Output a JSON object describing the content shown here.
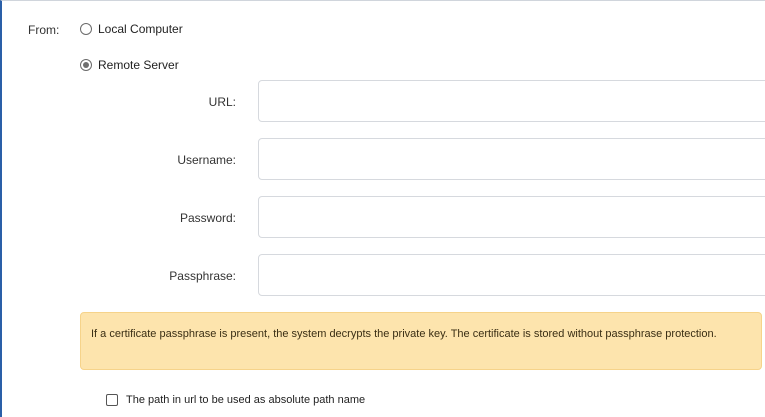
{
  "source": {
    "from_label": "From:",
    "options": [
      {
        "label": "Local Computer",
        "selected": false
      },
      {
        "label": "Remote Server",
        "selected": true
      }
    ]
  },
  "remote": {
    "url": {
      "label": "URL:",
      "value": ""
    },
    "username": {
      "label": "Username:",
      "value": ""
    },
    "password": {
      "label": "Password:",
      "value": ""
    },
    "passphrase": {
      "label": "Passphrase:",
      "value": ""
    }
  },
  "notice": {
    "text": "If a certificate passphrase is present, the system decrypts the private key. The certificate is stored without passphrase protection."
  },
  "absolute_path": {
    "label": "The path in url to be used as absolute path name",
    "checked": false
  },
  "colors": {
    "notice_background": "#fde4ad",
    "frame_accent": "#2a5fa8"
  }
}
